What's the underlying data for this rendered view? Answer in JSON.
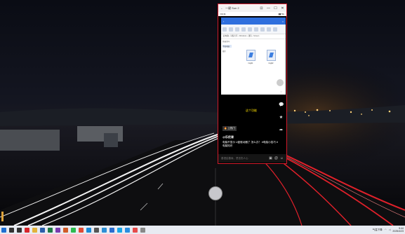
{
  "window": {
    "title": "一键 Sun 2",
    "controls": [
      "—",
      "☐",
      "✕"
    ]
  },
  "phone": {
    "status_left": "19:41",
    "status_right": "▮▮ 5G",
    "embedded_app": {
      "path": "此电脑 › 平板共享 › Windows › 钱包 › Screen",
      "sidebar": [
        "快速访问",
        "平板电脑",
        "图片"
      ],
      "files": [
        {
          "name": "img01"
        },
        {
          "name": "img02"
        },
        {
          "name": "img03"
        }
      ]
    },
    "video_caption": "这个功能",
    "tag": "🔥 上热门",
    "author": "@乐优课",
    "description": "电脑不显示 U盘驱动器了 怎么办？ #电脑小技巧 #电脑知识",
    "comment_placeholder": "善语结善缘，恶言伤人心",
    "actions": [
      "♥",
      "💬",
      "★",
      "➦"
    ]
  },
  "taskbar": {
    "weather": "气温下降",
    "time": "5:44",
    "date": "2025/4/23",
    "apps": [
      {
        "icon": "start-icon",
        "color": "#1f6fd1"
      },
      {
        "icon": "search-icon",
        "color": "#333"
      },
      {
        "icon": "task-view-icon",
        "color": "#333"
      },
      {
        "icon": "app-red-icon",
        "color": "#d7262b"
      },
      {
        "icon": "folder-icon",
        "color": "#e2b23a"
      },
      {
        "icon": "word-icon",
        "color": "#2b5faa"
      },
      {
        "icon": "excel-icon",
        "color": "#1f7a46"
      },
      {
        "icon": "onenote-icon",
        "color": "#7a3bb0"
      },
      {
        "icon": "powerpoint-icon",
        "color": "#d15b28"
      },
      {
        "icon": "wechat-icon",
        "color": "#2dbb4e"
      },
      {
        "icon": "chrome-icon",
        "color": "#e24a33"
      },
      {
        "icon": "edge-icon",
        "color": "#1c8ad6"
      },
      {
        "icon": "settings-icon",
        "color": "#555"
      },
      {
        "icon": "photos-icon",
        "color": "#2d8fd5"
      },
      {
        "icon": "mail-icon",
        "color": "#2a6dd0"
      },
      {
        "icon": "qq-icon",
        "color": "#1aa5e6"
      },
      {
        "icon": "browser-icon",
        "color": "#2a8ee0"
      },
      {
        "icon": "video-icon",
        "color": "#e64b4b"
      },
      {
        "icon": "phone-mirror-icon",
        "color": "#888"
      }
    ]
  }
}
